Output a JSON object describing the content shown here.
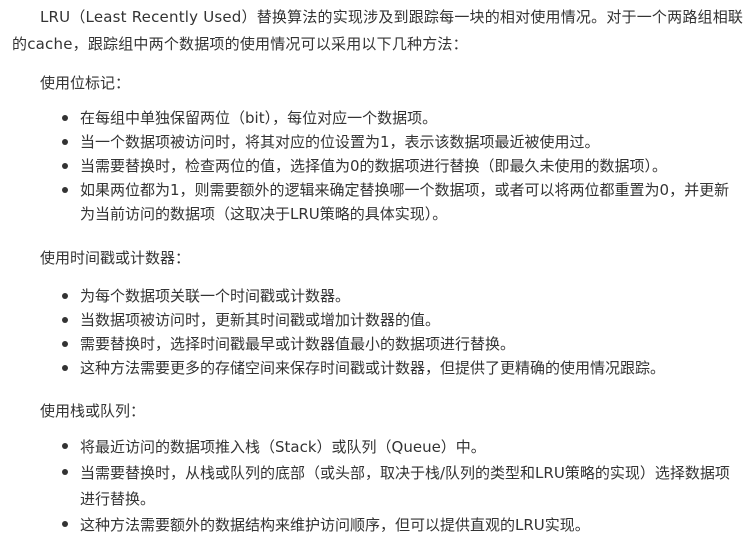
{
  "intro": "LRU（Least Recently Used）替换算法的实现涉及到跟踪每一块的相对使用情况。对于一个两路组相联的cache，跟踪组中两个数据项的使用情况可以采用以下几种方法：",
  "sections": [
    {
      "heading": "使用位标记：",
      "items": [
        "在每组中单独保留两位（bit），每位对应一个数据项。",
        "当一个数据项被访问时，将其对应的位设置为1，表示该数据项最近被使用过。",
        "当需要替换时，检查两位的值，选择值为0的数据项进行替换（即最久未使用的数据项）。",
        "如果两位都为1，则需要额外的逻辑来确定替换哪一个数据项，或者可以将两位都重置为0，并更新为当前访问的数据项（这取决于LRU策略的具体实现）。"
      ]
    },
    {
      "heading": "使用时间戳或计数器：",
      "items": [
        "为每个数据项关联一个时间戳或计数器。",
        "当数据项被访问时，更新其时间戳或增加计数器的值。",
        "需要替换时，选择时间戳最早或计数器值最小的数据项进行替换。",
        "这种方法需要更多的存储空间来保存时间戳或计数器，但提供了更精确的使用情况跟踪。"
      ]
    },
    {
      "heading": "使用栈或队列：",
      "items": [
        "将最近访问的数据项推入栈（Stack）或队列（Queue）中。",
        "当需要替换时，从栈或队列的底部（或头部，取决于栈/队列的类型和LRU策略的实现）选择数据项进行替换。",
        "这种方法需要额外的数据结构来维护访问顺序，但可以提供直观的LRU实现。"
      ]
    }
  ]
}
